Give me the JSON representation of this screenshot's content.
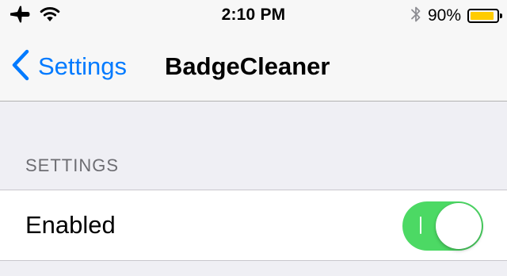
{
  "status_bar": {
    "time": "2:10 PM",
    "battery_percent": "90%",
    "battery_level": 0.9,
    "icons": [
      "airplane-icon",
      "wifi-icon",
      "bluetooth-icon",
      "battery-icon"
    ]
  },
  "nav": {
    "back_label": "Settings",
    "title": "BadgeCleaner"
  },
  "section": {
    "header": "SETTINGS"
  },
  "cells": [
    {
      "label": "Enabled",
      "toggle_on": true
    }
  ],
  "colors": {
    "accent": "#007aff",
    "toggle_on": "#4cd964",
    "battery_fill": "#ffcc00",
    "background": "#efeff4",
    "section_header": "#6d6d72"
  }
}
